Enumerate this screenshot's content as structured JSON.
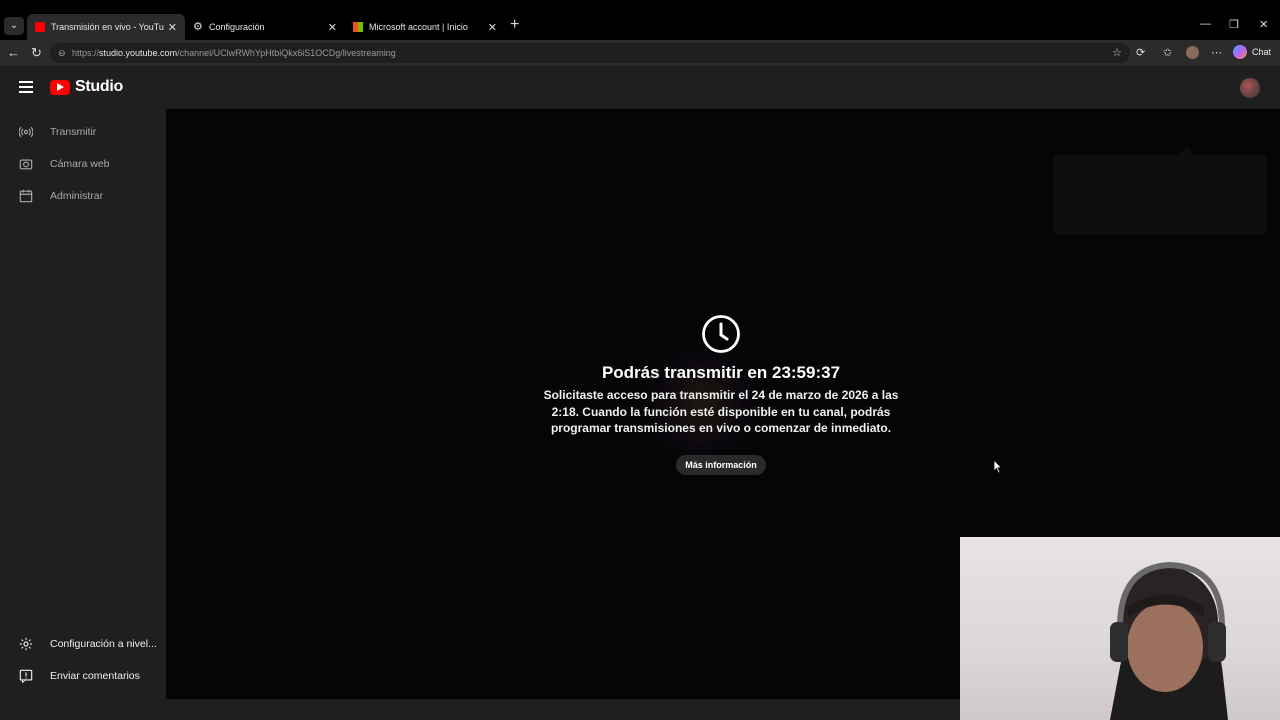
{
  "browser": {
    "tabs": [
      {
        "title": "Transmisión en vivo - YouTube Stu",
        "favicon": "youtube-favicon"
      },
      {
        "title": "Configuración",
        "favicon": "gear-favicon"
      },
      {
        "title": "Microsoft account | Inicio",
        "favicon": "microsoft-favicon"
      }
    ],
    "url_prefix": "https://",
    "url_host": "studio.youtube.com",
    "url_path": "/channel/UClwRWhYpHtbiQkx6iS1OCDg/livestreaming",
    "copilot_label": "Chat"
  },
  "app": {
    "logo_text": "Studio",
    "brand_color": "#ff0000"
  },
  "sidebar": {
    "items": [
      {
        "label": "Transmitir",
        "icon": "broadcast-icon"
      },
      {
        "label": "Cámara web",
        "icon": "camera-icon"
      },
      {
        "label": "Administrar",
        "icon": "calendar-icon"
      }
    ],
    "bottom_items": [
      {
        "label": "Configuración a nivel...",
        "icon": "gear-icon"
      },
      {
        "label": "Enviar comentarios",
        "icon": "feedback-icon"
      }
    ]
  },
  "main": {
    "heading": "Podrás transmitir en 23:59:37",
    "body": "Solicitaste acceso para transmitir el 24 de marzo de 2026 a las 2:18. Cuando la función esté disponible en tu canal, podrás programar transmisiones en vivo o comenzar de inmediato.",
    "more_info_label": "Más información"
  }
}
